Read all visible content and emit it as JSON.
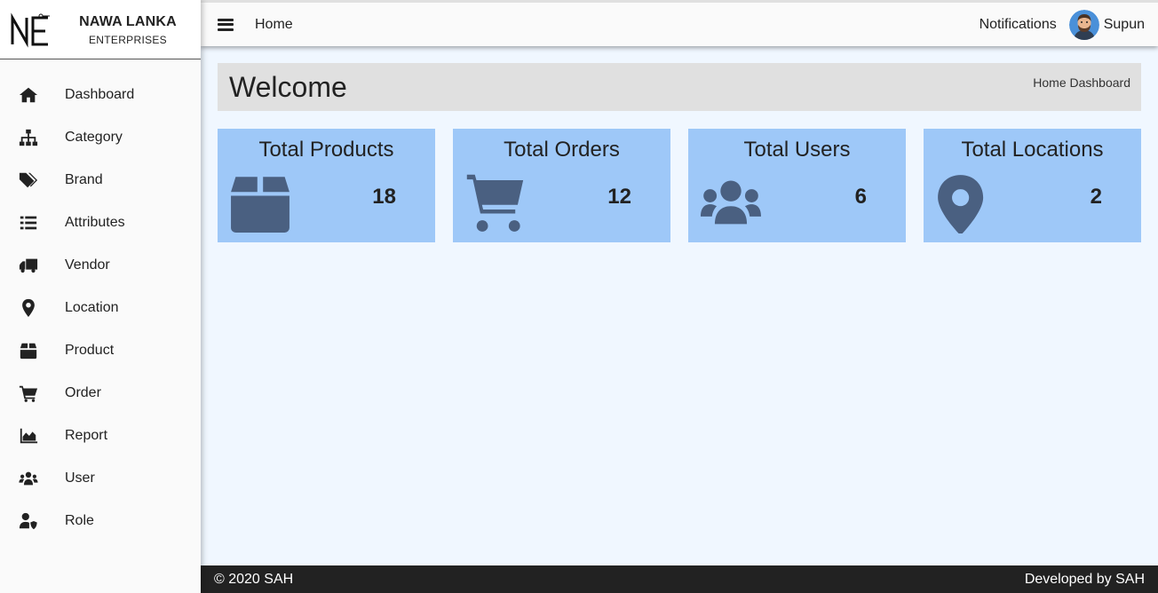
{
  "brand": {
    "name": "NAWA LANKA",
    "subtitle": "ENTERPRISES",
    "logo_text": "NE"
  },
  "sidebar": {
    "items": [
      {
        "label": "Dashboard",
        "icon": "home-icon"
      },
      {
        "label": "Category",
        "icon": "sitemap-icon"
      },
      {
        "label": "Brand",
        "icon": "tags-icon"
      },
      {
        "label": "Attributes",
        "icon": "list-icon"
      },
      {
        "label": "Vendor",
        "icon": "truck-icon"
      },
      {
        "label": "Location",
        "icon": "map-marker-icon"
      },
      {
        "label": "Product",
        "icon": "box-icon"
      },
      {
        "label": "Order",
        "icon": "cart-icon"
      },
      {
        "label": "Report",
        "icon": "area-chart-icon"
      },
      {
        "label": "User",
        "icon": "users-icon"
      },
      {
        "label": "Role",
        "icon": "user-shield-icon"
      }
    ]
  },
  "topbar": {
    "home": "Home",
    "notifications": "Notifications",
    "user": "Supun"
  },
  "main": {
    "welcome": "Welcome",
    "breadcrumb": "Home Dashboard",
    "cards": [
      {
        "title": "Total Products",
        "value": "18",
        "icon": "box-icon"
      },
      {
        "title": "Total Orders",
        "value": "12",
        "icon": "cart-icon"
      },
      {
        "title": "Total Users",
        "value": "6",
        "icon": "users-icon"
      },
      {
        "title": "Total Locations",
        "value": "2",
        "icon": "map-marker-icon"
      }
    ]
  },
  "footer": {
    "left": "© 2020 SAH",
    "right": "Developed by SAH"
  },
  "colors": {
    "card_bg": "#9ec8f8",
    "card_icon": "#4a6081",
    "page_bg": "#f0f7ff",
    "footer_bg": "#222222"
  }
}
